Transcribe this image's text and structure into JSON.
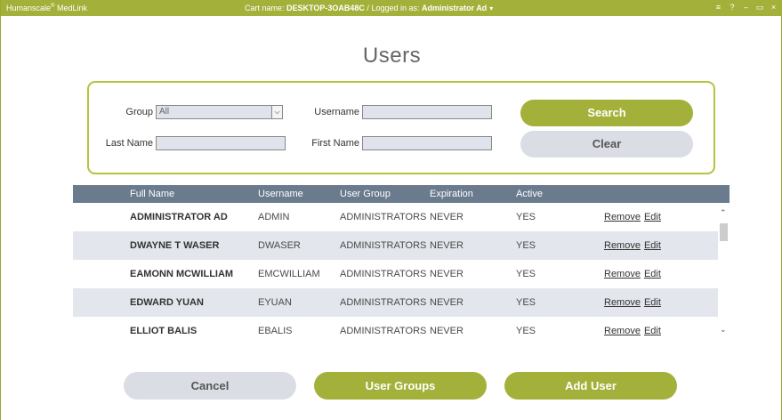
{
  "titlebar": {
    "brand": "Humanscale",
    "brand_mark": "®",
    "brand_suffix": " MedLink",
    "cart_label": "Cart name:",
    "cart_name": "DESKTOP-3OAB48C",
    "separator": "/",
    "logged_label": "Logged in as:",
    "logged_user": "Administrator Ad",
    "caret": "▾",
    "controls": [
      "≡",
      "?",
      "–",
      "▭",
      "×"
    ]
  },
  "page": {
    "title": "Users"
  },
  "search": {
    "group_label": "Group",
    "group_value": "All",
    "username_label": "Username",
    "username_value": "",
    "lastname_label": "Last Name",
    "lastname_value": "",
    "firstname_label": "First Name",
    "firstname_value": "",
    "search_button": "Search",
    "clear_button": "Clear"
  },
  "table": {
    "columns": [
      "Full Name",
      "Username",
      "User Group",
      "Expiration",
      "Active"
    ],
    "rows": [
      {
        "full_name": "ADMINISTRATOR AD",
        "username": "ADMIN",
        "group": "ADMINISTRATORS",
        "expiration": "NEVER",
        "active": "YES"
      },
      {
        "full_name": "DWAYNE T WASER",
        "username": "DWASER",
        "group": "ADMINISTRATORS",
        "expiration": "NEVER",
        "active": "YES"
      },
      {
        "full_name": "EAMONN MCWILLIAM",
        "username": "EMCWILLIAM",
        "group": "ADMINISTRATORS",
        "expiration": "NEVER",
        "active": "YES"
      },
      {
        "full_name": "EDWARD YUAN",
        "username": "EYUAN",
        "group": "ADMINISTRATORS",
        "expiration": "NEVER",
        "active": "YES"
      },
      {
        "full_name": "ELLIOT BALIS",
        "username": "EBALIS",
        "group": "ADMINISTRATORS",
        "expiration": "NEVER",
        "active": "YES"
      }
    ],
    "remove_label": "Remove",
    "edit_label": "Edit"
  },
  "footer": {
    "cancel_button": "Cancel",
    "user_groups_button": "User Groups",
    "add_user_button": "Add User"
  },
  "colors": {
    "accent": "#a3b13a",
    "header_bg": "#6b7b8e",
    "row_alt": "#e3e6ec",
    "button_gray": "#dadde4"
  }
}
